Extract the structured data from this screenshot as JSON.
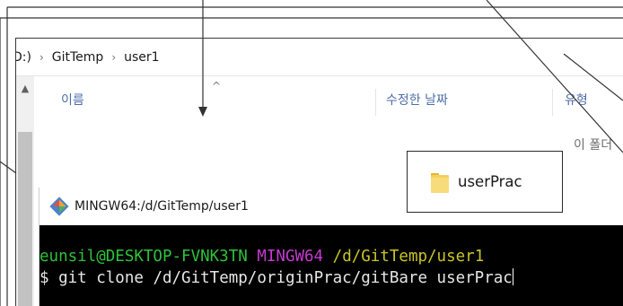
{
  "explorer": {
    "breadcrumb": [
      "D:)",
      "GitTemp",
      "user1"
    ],
    "columns": {
      "name": "이름",
      "date_modified": "수정한 날짜",
      "type": "유형"
    },
    "empty_message": "이 폴더"
  },
  "terminal": {
    "title": "MINGW64:/d/GitTemp/user1",
    "prompt_user": "eunsil@DESKTOP-FVNK3TN",
    "prompt_env": "MINGW64",
    "prompt_path": "/d/GitTemp/user1",
    "command_symbol": "$",
    "command": "git clone /d/GitTemp/originPrac/gitBare userPrac",
    "colors": {
      "user": "#2dc33a",
      "env": "#c73ad1",
      "path": "#c9c528",
      "text": "#e6e6e6"
    }
  },
  "callout": {
    "folder_name": "userPrac"
  },
  "icons": {
    "scroll_up": "▲",
    "sort": "^",
    "breadcrumb_separator": "›"
  }
}
